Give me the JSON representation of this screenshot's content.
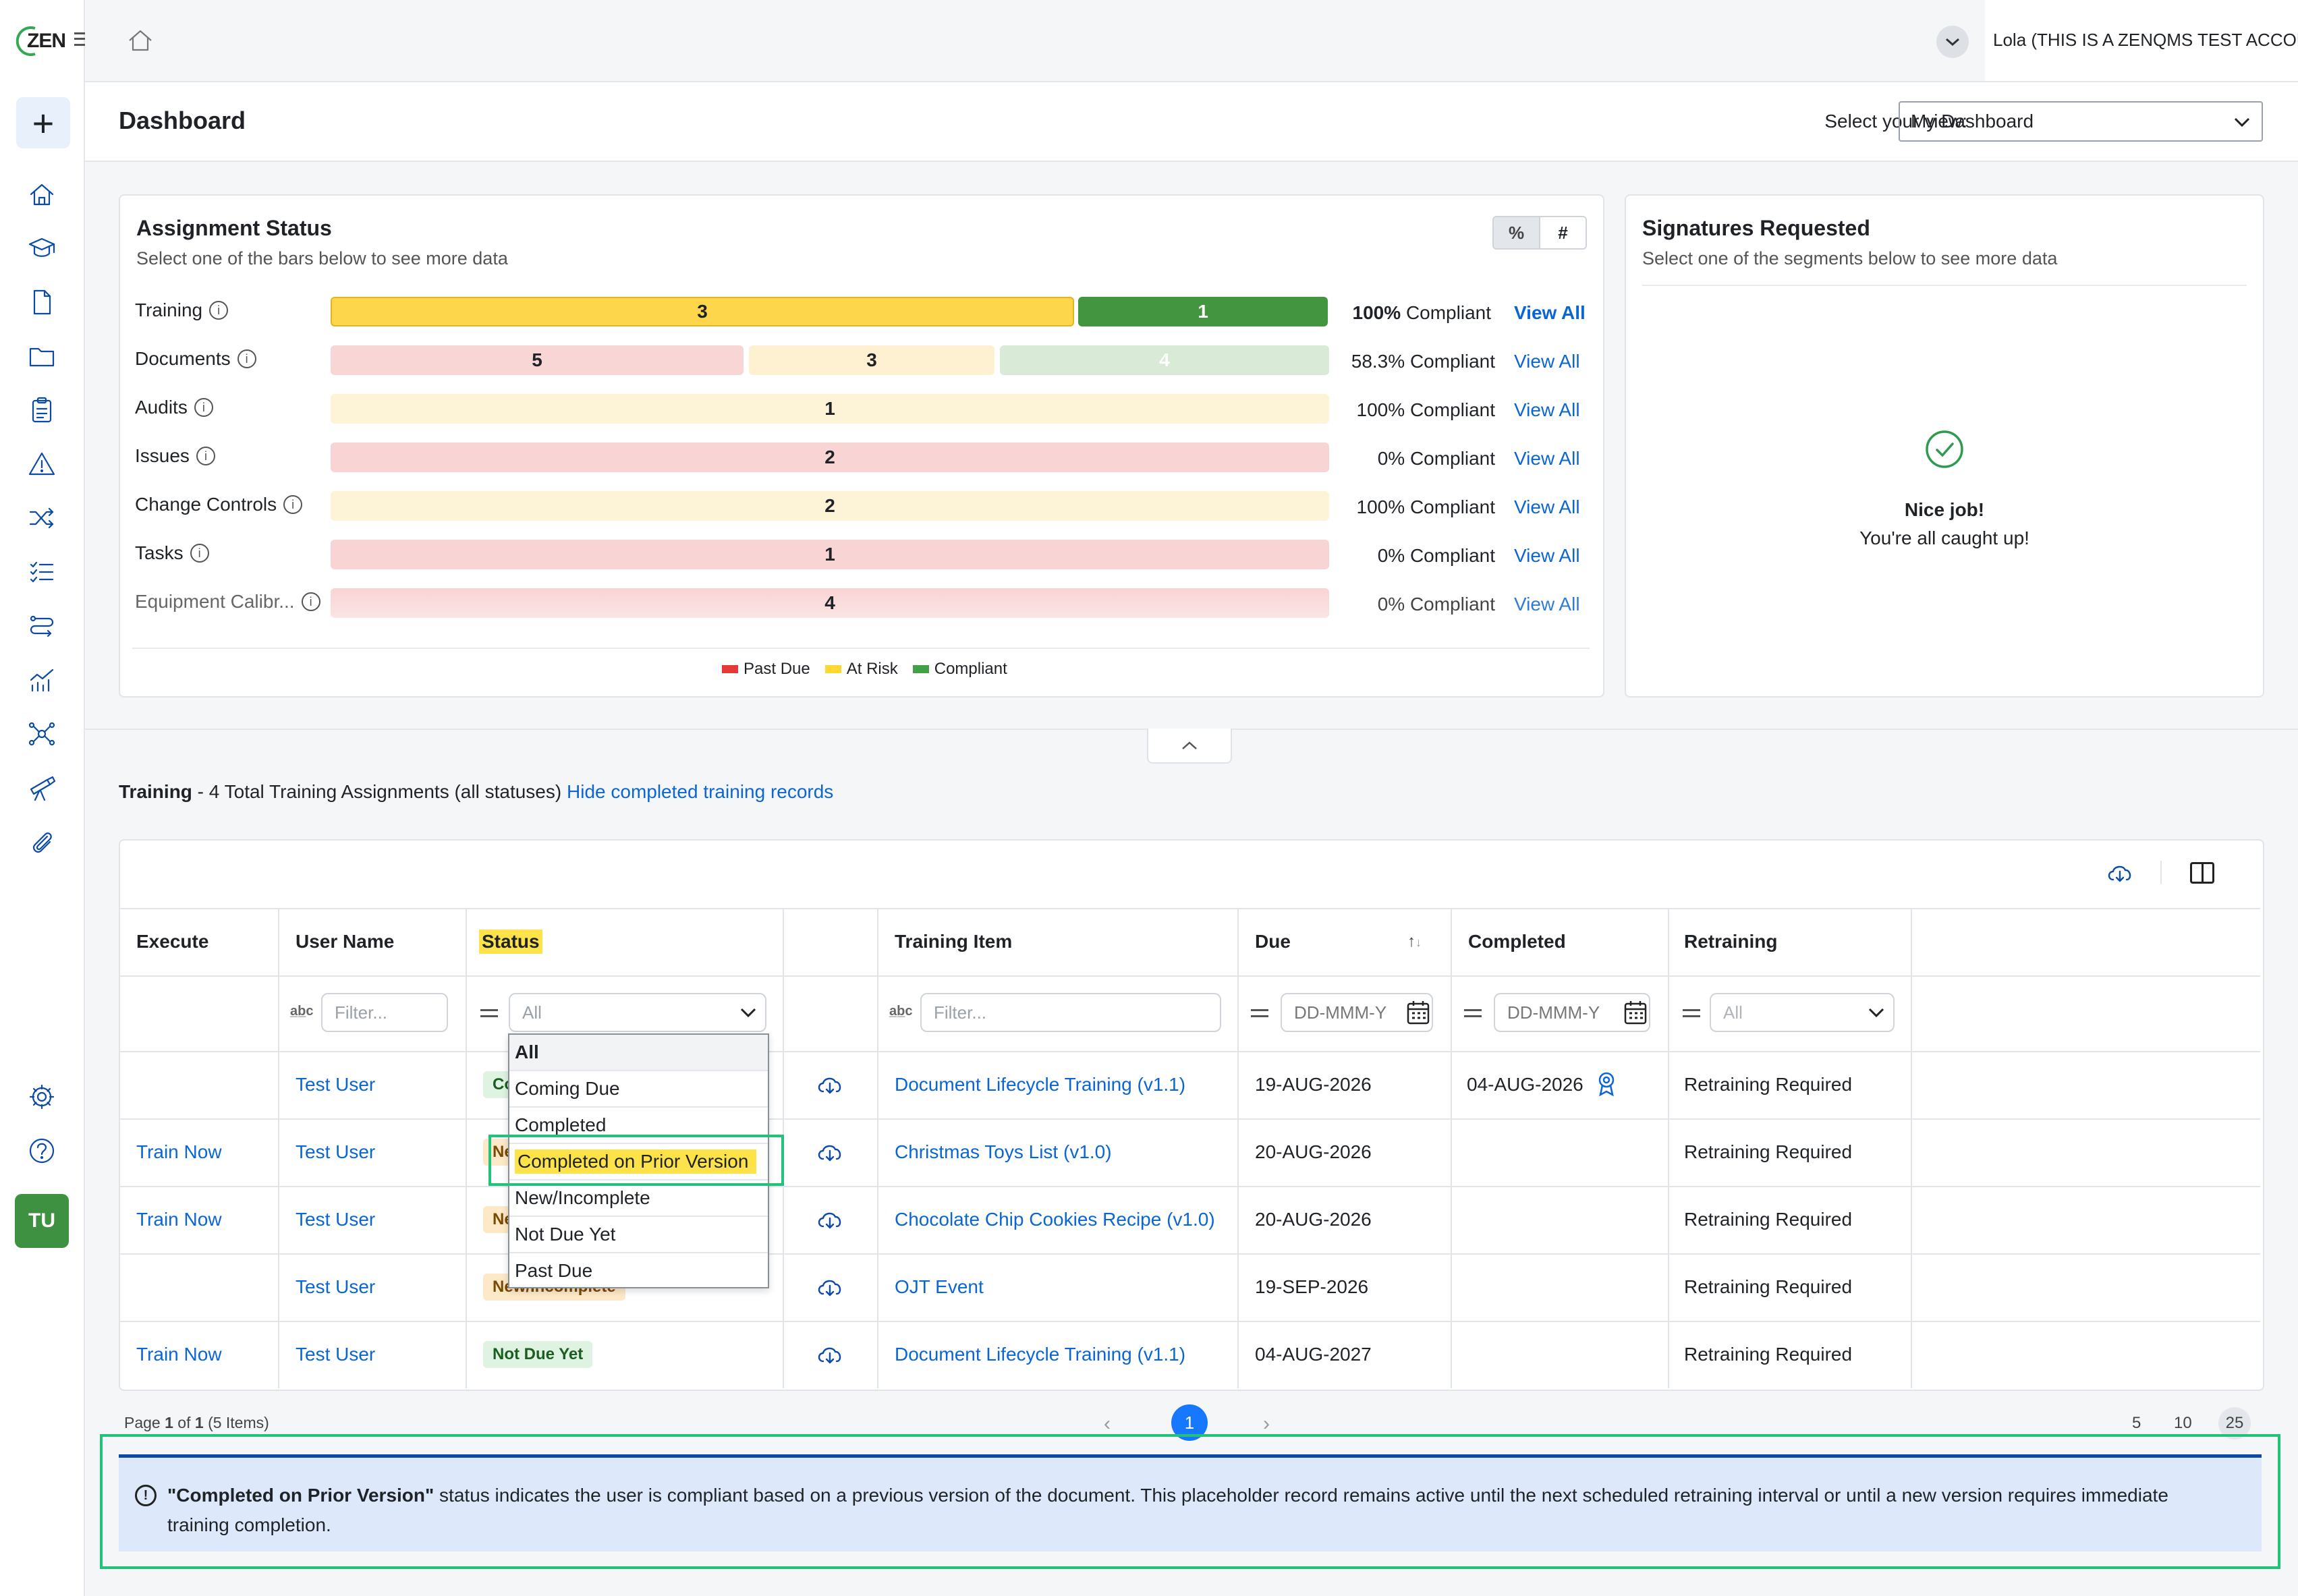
{
  "app": {
    "logo_text": "ZEN",
    "account": "Lola (THIS IS A ZENQMS TEST ACCOUNT)",
    "avatar_initials": "TU"
  },
  "header": {
    "title": "Dashboard",
    "view_label": "Select your view:",
    "view_value": "My Dashboard"
  },
  "assignment_status": {
    "title": "Assignment Status",
    "subtitle": "Select one of the bars below to see more data",
    "toggle_pct": "%",
    "toggle_num": "#",
    "view_all": "View All",
    "rows": [
      {
        "label": "Training",
        "segments": [
          "3",
          "1"
        ],
        "pct": "100%",
        "suffix": "Compliant"
      },
      {
        "label": "Documents",
        "segments": [
          "5",
          "3",
          "4"
        ],
        "pct": "58.3%",
        "suffix": "Compliant"
      },
      {
        "label": "Audits",
        "segments": [
          "1"
        ],
        "pct": "100%",
        "suffix": "Compliant"
      },
      {
        "label": "Issues",
        "segments": [
          "2"
        ],
        "pct": "0%",
        "suffix": "Compliant"
      },
      {
        "label": "Change Controls",
        "segments": [
          "2"
        ],
        "pct": "100%",
        "suffix": "Compliant"
      },
      {
        "label": "Tasks",
        "segments": [
          "1"
        ],
        "pct": "0%",
        "suffix": "Compliant"
      },
      {
        "label": "Equipment Calibr...",
        "segments": [
          "4"
        ],
        "pct": "0%",
        "suffix": "Compliant"
      }
    ],
    "legend": [
      "Past Due",
      "At Risk",
      "Compliant"
    ],
    "colors": {
      "past_due": "#e53935",
      "at_risk": "#fdd835",
      "compliant": "#43a047"
    }
  },
  "signatures": {
    "title": "Signatures Requested",
    "subtitle": "Select one of the segments below to see more data",
    "nice": "Nice job!",
    "caught_up": "You're all caught up!"
  },
  "training": {
    "title": "Training",
    "summary": " - 4 Total Training Assignments (all statuses)",
    "hide_link": "Hide completed training records"
  },
  "table": {
    "headers": {
      "execute": "Execute",
      "user": "User Name",
      "status": "Status",
      "item": "Training Item",
      "due": "Due",
      "completed": "Completed",
      "retraining": "Retraining"
    },
    "filters": {
      "user_ph": "Filter...",
      "status_val": "All",
      "item_ph": "Filter...",
      "due_ph": "DD-MMM-Y",
      "completed_ph": "DD-MMM-Y",
      "retraining_val": "All"
    },
    "rows": [
      {
        "execute": "",
        "user": "Test User",
        "status": "Co",
        "item": "Document Lifecycle Training (v1.1)",
        "due": "19-AUG-2026",
        "completed": "04-AUG-2026",
        "retraining": "Retraining Required"
      },
      {
        "execute": "Train Now",
        "user": "Test User",
        "status": "Ne",
        "item": "Christmas Toys List (v1.0)",
        "due": "20-AUG-2026",
        "completed": "",
        "retraining": "Retraining Required"
      },
      {
        "execute": "Train Now",
        "user": "Test User",
        "status": "Ne",
        "item": "Chocolate Chip Cookies Recipe (v1.0)",
        "due": "20-AUG-2026",
        "completed": "",
        "retraining": "Retraining Required"
      },
      {
        "execute": "",
        "user": "Test User",
        "status": "New/Incomplete",
        "item": "OJT Event",
        "due": "19-SEP-2026",
        "completed": "",
        "retraining": "Retraining Required"
      },
      {
        "execute": "Train Now",
        "user": "Test User",
        "status": "Not Due Yet",
        "item": "Document Lifecycle Training (v1.1)",
        "due": "04-AUG-2027",
        "completed": "",
        "retraining": "Retraining Required"
      }
    ],
    "dropdown_options": [
      "All",
      "Coming Due",
      "Completed",
      "Completed on Prior Version",
      "New/Incomplete",
      "Not Due Yet",
      "Past Due"
    ]
  },
  "pagination": {
    "page_word": "Page",
    "page": "1",
    "of_word": "of",
    "total": "1",
    "items": "(5 Items)",
    "current": "1",
    "sizes": [
      "5",
      "10",
      "25"
    ]
  },
  "notice": {
    "bold": "\"Completed on Prior Version\"",
    "text": " status indicates the user is compliant based on a previous version of the document. This placeholder record remains active until the next scheduled retraining interval or until a new version requires immediate training completion."
  }
}
